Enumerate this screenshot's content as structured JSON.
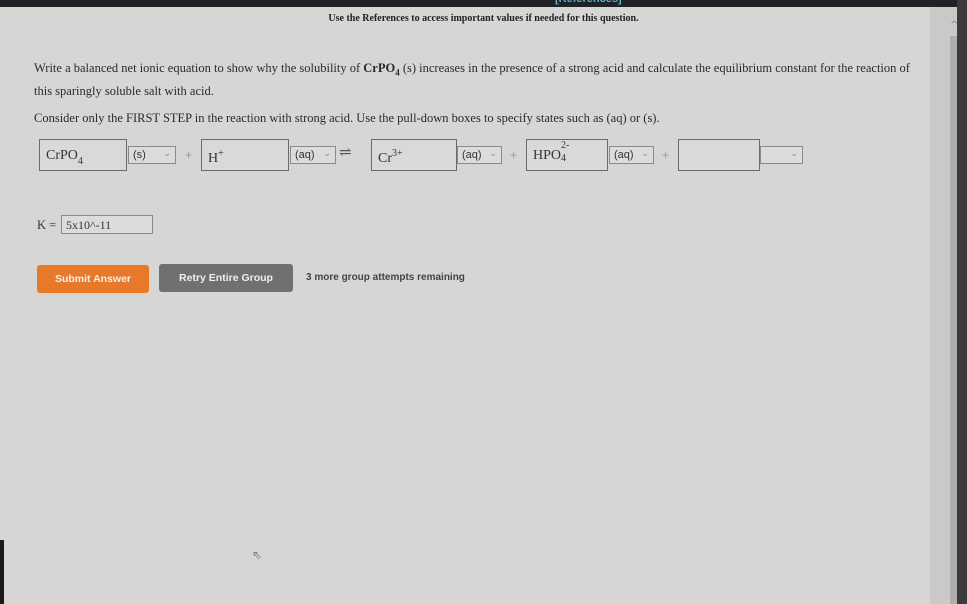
{
  "header": {
    "references_link": "[References]",
    "note": "Use the References to access important values if needed for this question."
  },
  "question": {
    "text_before": "Write a balanced net ionic equation to show why the solubility of ",
    "compound": "CrPO",
    "compound_sub": "4",
    "text_after": " (s) increases in the presence of a strong acid and calculate the equilibrium constant for the reaction of this sparingly soluble salt with acid.",
    "instruction": "Consider only the FIRST STEP in the reaction with strong acid. Use the pull-down boxes to specify states such as (aq) or (s)."
  },
  "equation": {
    "plus": "+",
    "equilibrium_arrow": "⇌",
    "reactants": [
      {
        "formula": "CrPO",
        "sub": "4",
        "sup": "",
        "state": "(s)"
      },
      {
        "formula": "H",
        "sub": "",
        "sup": "+",
        "state": "(aq)"
      }
    ],
    "products": [
      {
        "formula": "Cr",
        "sub": "",
        "sup": "3+",
        "state": "(aq)"
      },
      {
        "formula": "HPO",
        "sub": "4",
        "sup": "2-",
        "state": "(aq)"
      },
      {
        "formula": "",
        "sub": "",
        "sup": "",
        "state": ""
      }
    ],
    "chevron": "⌄"
  },
  "k": {
    "label": "K =",
    "value": "5x10^-11"
  },
  "buttons": {
    "submit": "Submit Answer",
    "retry": "Retry Entire Group"
  },
  "attempts_text": "3 more group attempts remaining",
  "icons": {
    "scroll_up": "^",
    "cursor": "⇖"
  }
}
